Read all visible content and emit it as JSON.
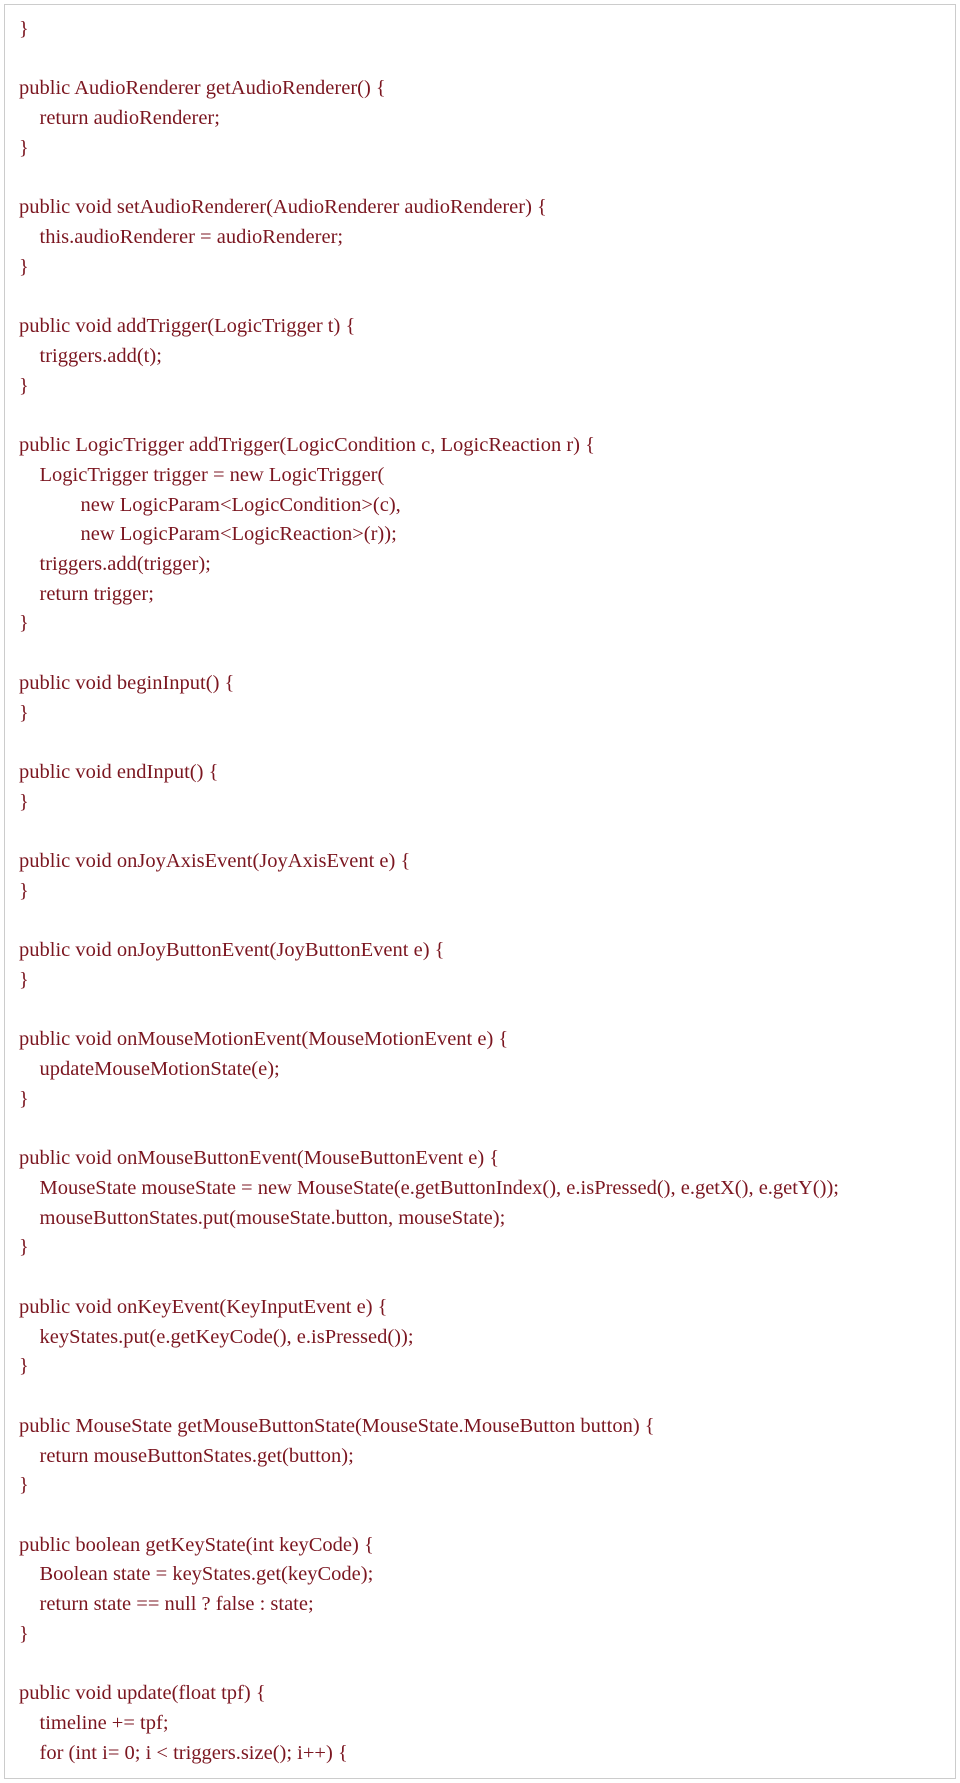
{
  "code": {
    "lines": [
      "}",
      "",
      "public AudioRenderer getAudioRenderer() {",
      "    return audioRenderer;",
      "}",
      "",
      "public void setAudioRenderer(AudioRenderer audioRenderer) {",
      "    this.audioRenderer = audioRenderer;",
      "}",
      "",
      "public void addTrigger(LogicTrigger t) {",
      "    triggers.add(t);",
      "}",
      "",
      "public LogicTrigger addTrigger(LogicCondition c, LogicReaction r) {",
      "    LogicTrigger trigger = new LogicTrigger(",
      "            new LogicParam<LogicCondition>(c),",
      "            new LogicParam<LogicReaction>(r));",
      "    triggers.add(trigger);",
      "    return trigger;",
      "}",
      "",
      "public void beginInput() {",
      "}",
      "",
      "public void endInput() {",
      "}",
      "",
      "public void onJoyAxisEvent(JoyAxisEvent e) {",
      "}",
      "",
      "public void onJoyButtonEvent(JoyButtonEvent e) {",
      "}",
      "",
      "public void onMouseMotionEvent(MouseMotionEvent e) {",
      "    updateMouseMotionState(e);",
      "}",
      "",
      "public void onMouseButtonEvent(MouseButtonEvent e) {",
      "    MouseState mouseState = new MouseState(e.getButtonIndex(), e.isPressed(), e.getX(), e.getY());",
      "    mouseButtonStates.put(mouseState.button, mouseState);",
      "}",
      "",
      "public void onKeyEvent(KeyInputEvent e) {",
      "    keyStates.put(e.getKeyCode(), e.isPressed());",
      "}",
      "",
      "public MouseState getMouseButtonState(MouseState.MouseButton button) {",
      "    return mouseButtonStates.get(button);",
      "}",
      "",
      "public boolean getKeyState(int keyCode) {",
      "    Boolean state = keyStates.get(keyCode);",
      "    return state == null ? false : state;",
      "}",
      "",
      "public void update(float tpf) {",
      "    timeline += tpf;",
      "    for (int i= 0; i < triggers.size(); i++) {"
    ]
  }
}
